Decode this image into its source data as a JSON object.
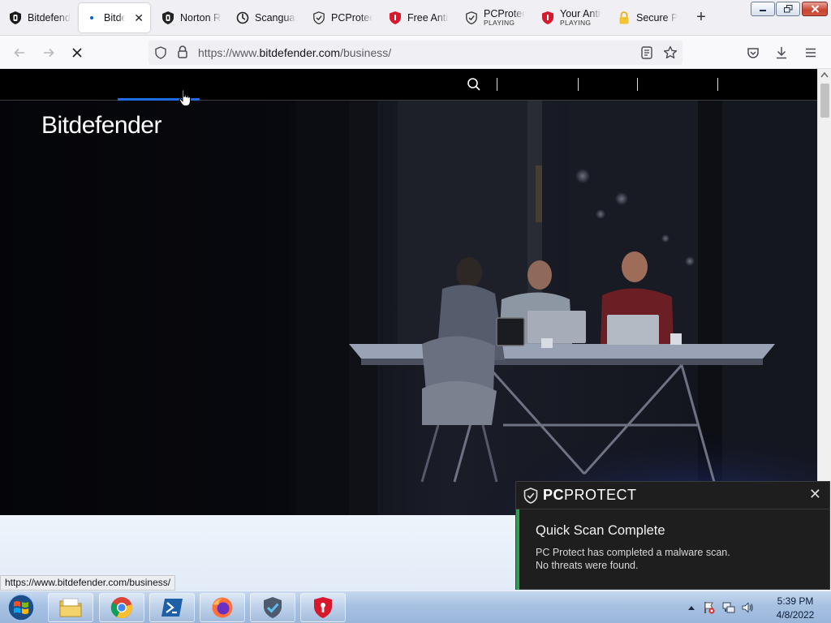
{
  "browser": {
    "tabs": [
      {
        "label": "Bitdefender",
        "sub": "",
        "active": false,
        "icon": "bitdefender-shield-icon"
      },
      {
        "label": "Bitdefender",
        "sub": "",
        "active": true,
        "icon": "loading-dot-icon"
      },
      {
        "label": "Norton Report",
        "sub": "",
        "active": false,
        "icon": "norton-shield-icon"
      },
      {
        "label": "Scanguard",
        "sub": "",
        "active": false,
        "icon": "scanguard-icon"
      },
      {
        "label": "PCProtect",
        "sub": "",
        "active": false,
        "icon": "pcprotect-shield-icon"
      },
      {
        "label": "Free Antivirus",
        "sub": "",
        "active": false,
        "icon": "red-shield-icon"
      },
      {
        "label": "PCProtect",
        "sub": "PLAYING",
        "active": false,
        "icon": "pcprotect-shield-icon"
      },
      {
        "label": "Your Antivirus",
        "sub": "PLAYING",
        "active": false,
        "icon": "red-shield-icon"
      },
      {
        "label": "Secure Page",
        "sub": "",
        "active": false,
        "icon": "padlock-icon"
      }
    ],
    "new_tab_symbol": "+",
    "url_prefix": "https://www.",
    "url_domain": "bitdefender.com",
    "url_path": "/business/",
    "status_url": "https://www.bitdefender.com/business/"
  },
  "page": {
    "brand": "Bitdefender"
  },
  "notification": {
    "brand_bold": "PC",
    "brand_rest": "PROTECT",
    "close_symbol": "✕",
    "title": "Quick Scan Complete",
    "line1": "PC Protect has completed a malware scan.",
    "line2": "No threats were found."
  },
  "taskbar": {
    "time": "5:39 PM",
    "date": "4/8/2022"
  },
  "colors": {
    "accent_green": "#2f9c52",
    "loading_blue": "#1e6ce6",
    "taskbar_blue": "#a7c1e2"
  }
}
